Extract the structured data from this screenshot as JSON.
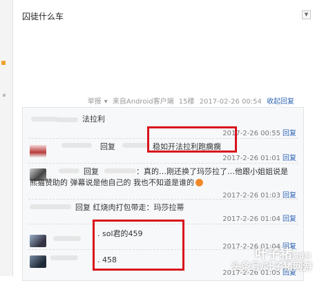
{
  "post": {
    "title": "囚徒什么车",
    "dropdown_icon": "chevron-down-icon",
    "meta": {
      "report": "举报",
      "report_caret": "▾",
      "source": "来自Android客户端",
      "floor": "15楼",
      "datetime": "2017-02-26 00:54",
      "collapse_label": "收起回复"
    }
  },
  "replies": [
    {
      "text": "法拉利",
      "time": "2017-2-26 00:55",
      "reply_label": "回复"
    },
    {
      "prefix": "回复",
      "text": "稳如开法拉利跑瘸瘸",
      "time": "2017-2-26 01:01",
      "reply_label": "回复"
    },
    {
      "prefix": "回复",
      "text_line1": "：真的…刚还换了玛莎拉了…他跟小姐姐说是",
      "text_line2": "熊猫赞助的 弹幕说是他自己的 我也不知道是谁的",
      "time": "2017-2-26 01:03",
      "reply_label": "回复"
    },
    {
      "text": "回复 红烧肉打包带走：玛莎拉蒂",
      "time": "2017-2-26 01:04",
      "reply_label": "回复"
    },
    {
      "text": ". sol君的459",
      "time": "2017-2-26 01:04",
      "reply_label": "回复"
    },
    {
      "text": ". 458",
      "time": "2017-2-26 01:05",
      "reply_label": "回复"
    }
  ],
  "watermark": {
    "brand": "叶子猪",
    "brand_sub": "游戏网",
    "line": "头条号/叶子猪网游"
  },
  "colors": {
    "link": "#2d64b3",
    "highlight_border": "#d8121c"
  }
}
